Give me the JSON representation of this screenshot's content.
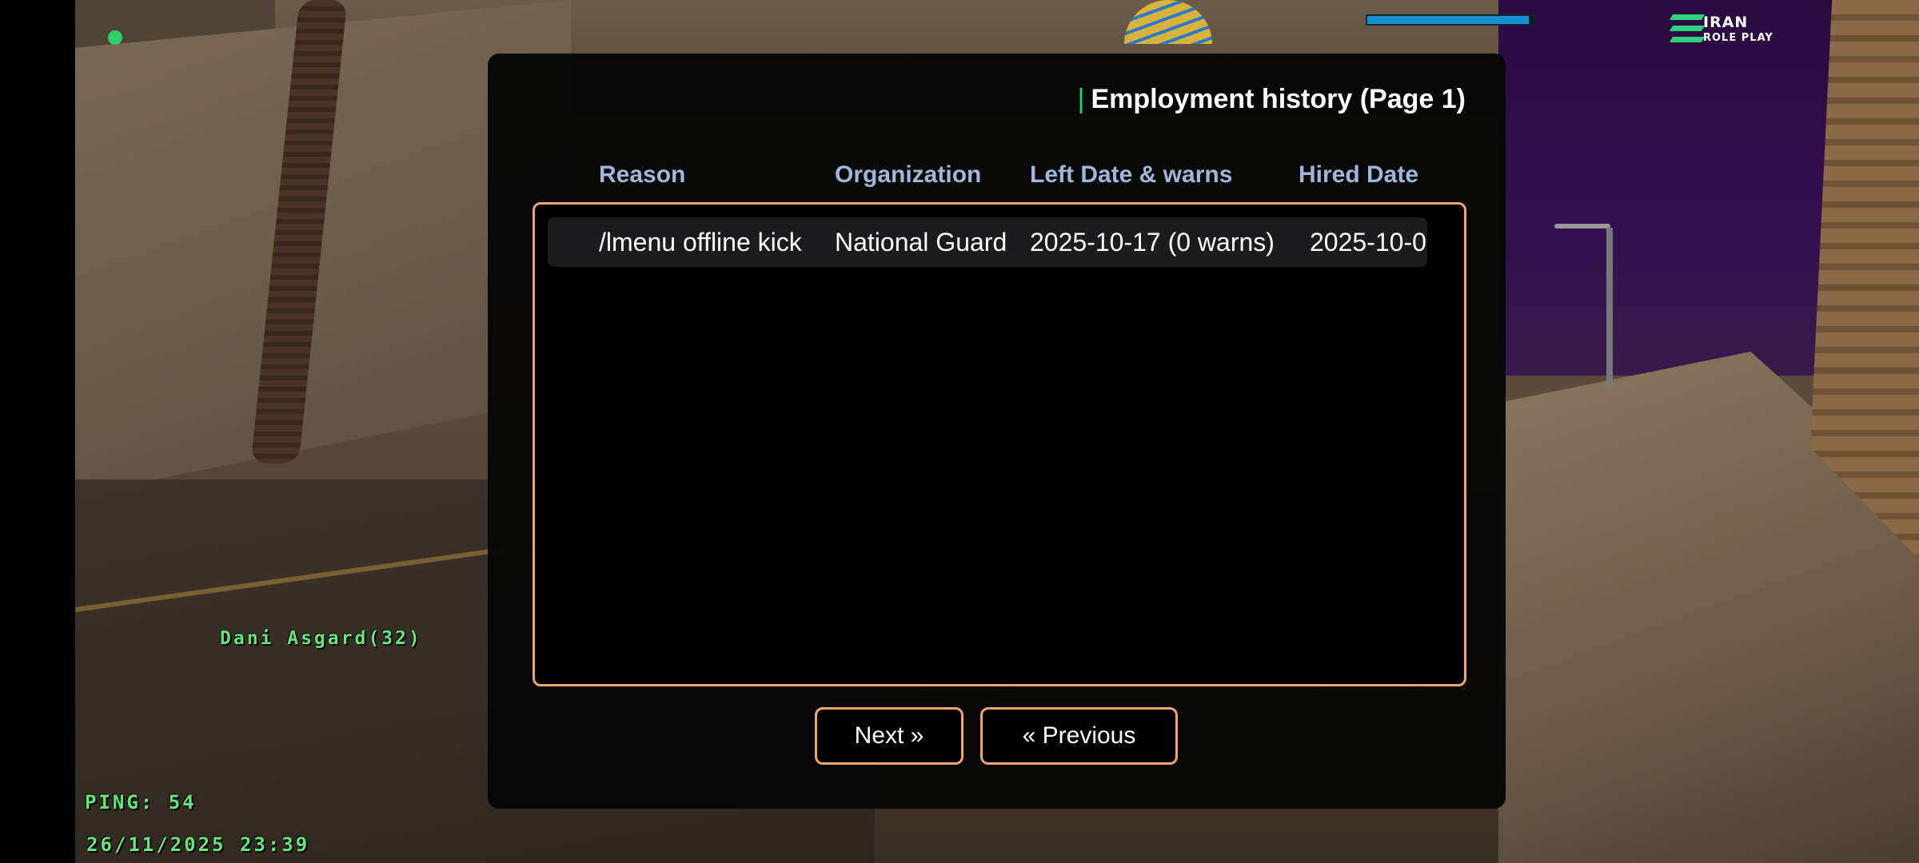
{
  "hud": {
    "player_name": "Dani Asgard(32)",
    "ping": "PING: 54",
    "datetime": "26/11/2025 23:39",
    "health_fraction": 0.97,
    "logo": {
      "brand": "IRAN",
      "sub": "ROLE PLAY"
    }
  },
  "dialog": {
    "title": "Employment history (Page 1)",
    "title_accent": "|",
    "columns": {
      "reason": "Reason",
      "organization": "Organization",
      "left_date": "Left Date & warns",
      "hired_date": "Hired Date"
    },
    "rows": [
      {
        "reason": "/lmenu offline kick",
        "organization": "National Guard",
        "left_date": "2025-10-17 (0 warns)",
        "hired_date": "2025-10-0"
      }
    ],
    "buttons": {
      "next": "Next »",
      "previous": "« Previous"
    }
  },
  "colors": {
    "accent_border": "#f0a56a",
    "header_text": "#9fb7dc",
    "hud_green": "#63e878",
    "title_accent": "#2fcf6a"
  },
  "icons": {
    "status": "status-dot-icon",
    "logo": "iran-roleplay-logo"
  }
}
